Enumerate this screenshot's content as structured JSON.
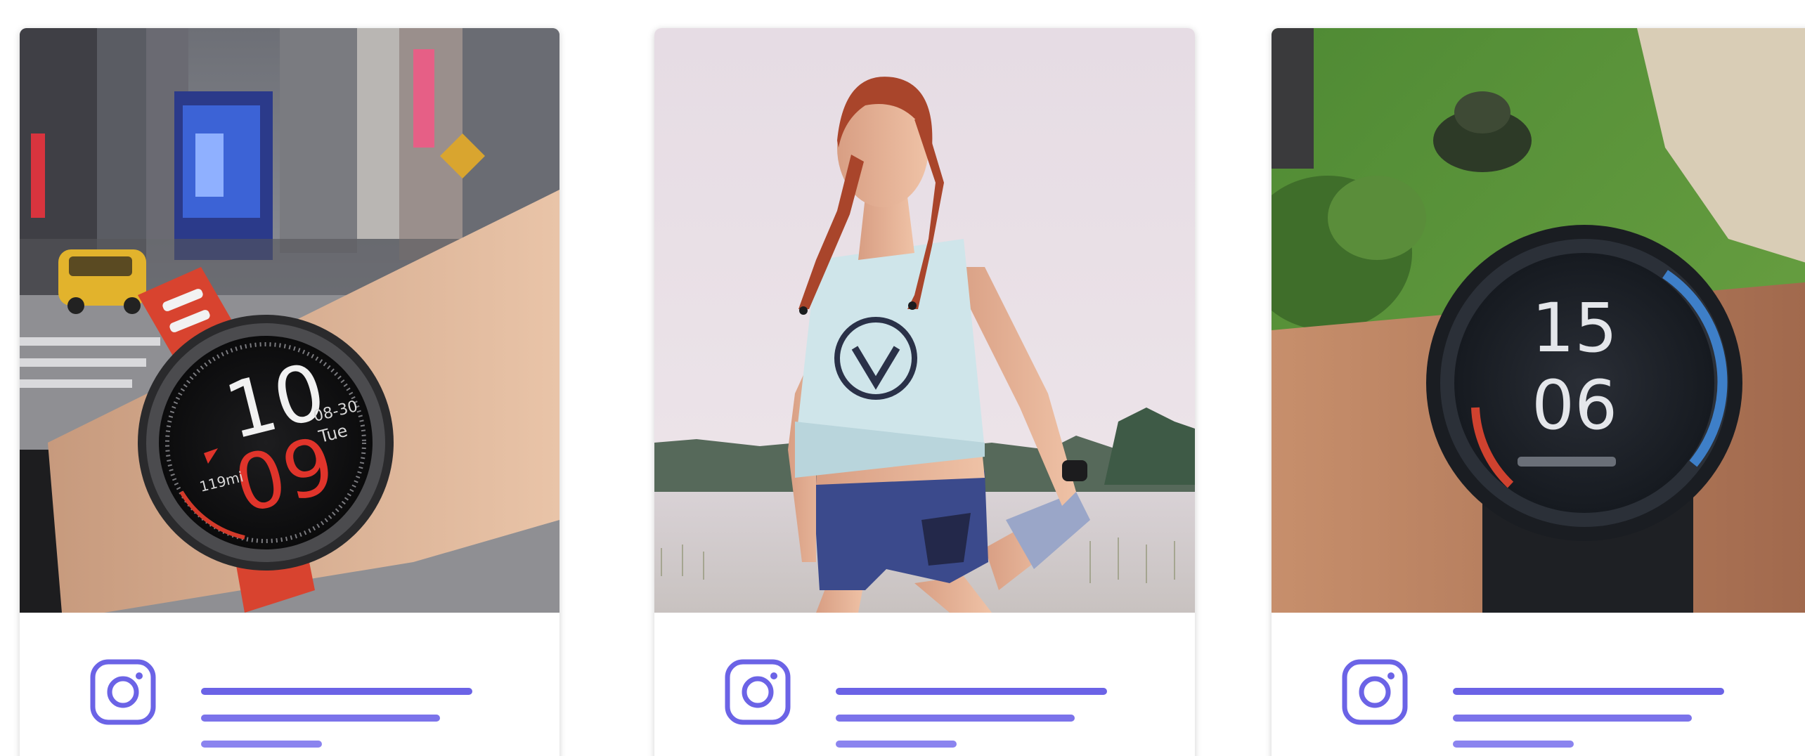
{
  "feed": {
    "posts": [
      {
        "image": "smartwatch-on-wrist-city-street",
        "watch_time": {
          "hour": "10",
          "minute": "09",
          "date": "08-30",
          "day": "Tue",
          "distance": "119mi"
        },
        "icon": "instagram-icon",
        "caption_lines": 3
      },
      {
        "image": "woman-stretching-by-lake",
        "icon": "instagram-icon",
        "caption_lines": 3
      },
      {
        "image": "blurred-smartwatch-on-wrist-park",
        "watch_time": {
          "hour": "15",
          "minute": "06"
        },
        "icon": "instagram-icon",
        "caption_lines": 3
      }
    ]
  },
  "colors": {
    "accent": "#6b63e6",
    "caption_line_1": "#6b63e6",
    "caption_line_2": "#7b73ea",
    "caption_line_3": "#8b84ef",
    "card_bg": "#ffffff"
  }
}
